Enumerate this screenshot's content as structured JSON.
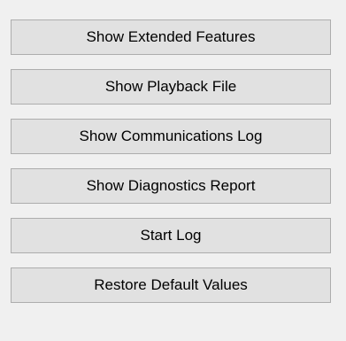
{
  "buttons": [
    {
      "label": "Show Extended Features"
    },
    {
      "label": "Show Playback File"
    },
    {
      "label": "Show Communications Log"
    },
    {
      "label": "Show Diagnostics Report"
    },
    {
      "label": "Start Log"
    },
    {
      "label": "Restore Default Values"
    }
  ],
  "colors": {
    "background": "#f0f0f0",
    "button_face": "#e1e1e1",
    "button_border": "#adadad",
    "text": "#000000"
  }
}
